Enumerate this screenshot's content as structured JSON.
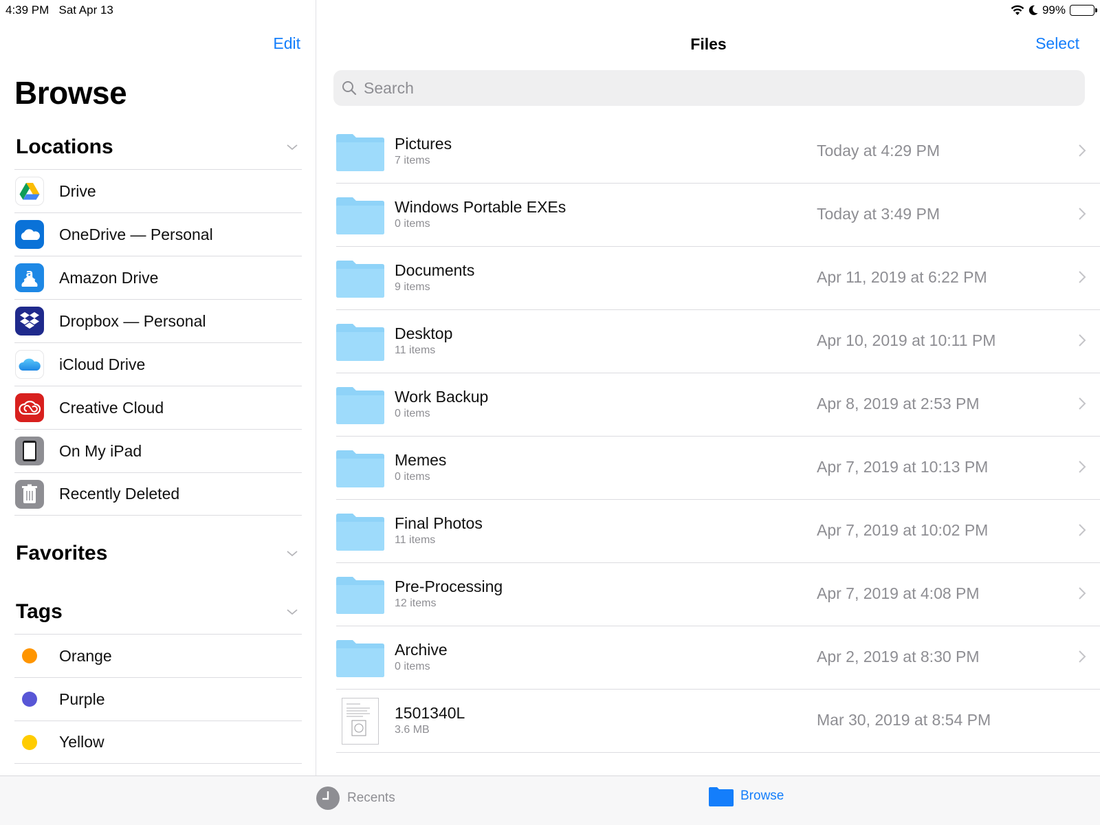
{
  "status": {
    "time": "4:39 PM",
    "date": "Sat Apr 13",
    "battery": "99%",
    "battery_level": 0.99
  },
  "sidebar": {
    "edit_label": "Edit",
    "title": "Browse",
    "locations_title": "Locations",
    "locations": [
      {
        "label": "Drive",
        "icon": "google-drive-icon"
      },
      {
        "label": "OneDrive — Personal",
        "icon": "onedrive-icon"
      },
      {
        "label": "Amazon Drive",
        "icon": "amazon-drive-icon"
      },
      {
        "label": "Dropbox — Personal",
        "icon": "dropbox-icon"
      },
      {
        "label": "iCloud Drive",
        "icon": "icloud-icon"
      },
      {
        "label": "Creative Cloud",
        "icon": "creative-cloud-icon"
      },
      {
        "label": "On My iPad",
        "icon": "ipad-icon"
      },
      {
        "label": "Recently Deleted",
        "icon": "trash-icon"
      }
    ],
    "favorites_title": "Favorites",
    "tags_title": "Tags",
    "tags": [
      {
        "label": "Orange",
        "color": "#ff9500"
      },
      {
        "label": "Purple",
        "color": "#5856d6"
      },
      {
        "label": "Yellow",
        "color": "#ffcc00"
      }
    ]
  },
  "main": {
    "title": "Files",
    "select_label": "Select",
    "search_placeholder": "Search",
    "files": [
      {
        "name": "Pictures",
        "meta": "7 items",
        "date": "Today at 4:29 PM",
        "type": "folder"
      },
      {
        "name": "Windows Portable EXEs",
        "meta": "0 items",
        "date": "Today at 3:49 PM",
        "type": "folder"
      },
      {
        "name": "Documents",
        "meta": "9 items",
        "date": "Apr 11, 2019 at 6:22 PM",
        "type": "folder"
      },
      {
        "name": "Desktop",
        "meta": "11 items",
        "date": "Apr 10, 2019 at 10:11 PM",
        "type": "folder"
      },
      {
        "name": "Work Backup",
        "meta": "0 items",
        "date": "Apr 8, 2019 at 2:53 PM",
        "type": "folder"
      },
      {
        "name": "Memes",
        "meta": "0 items",
        "date": "Apr 7, 2019 at 10:13 PM",
        "type": "folder"
      },
      {
        "name": "Final Photos",
        "meta": "11 items",
        "date": "Apr 7, 2019 at 10:02 PM",
        "type": "folder"
      },
      {
        "name": "Pre-Processing",
        "meta": "12 items",
        "date": "Apr 7, 2019 at 4:08 PM",
        "type": "folder"
      },
      {
        "name": "Archive",
        "meta": "0 items",
        "date": "Apr 2, 2019 at 8:30 PM",
        "type": "folder"
      },
      {
        "name": "1501340L",
        "meta": "3.6 MB",
        "date": "Mar 30, 2019 at 8:54 PM",
        "type": "document"
      }
    ]
  },
  "tabbar": {
    "recents_label": "Recents",
    "browse_label": "Browse"
  },
  "colors": {
    "accent": "#147efb",
    "folder": "#8fd3f8"
  }
}
